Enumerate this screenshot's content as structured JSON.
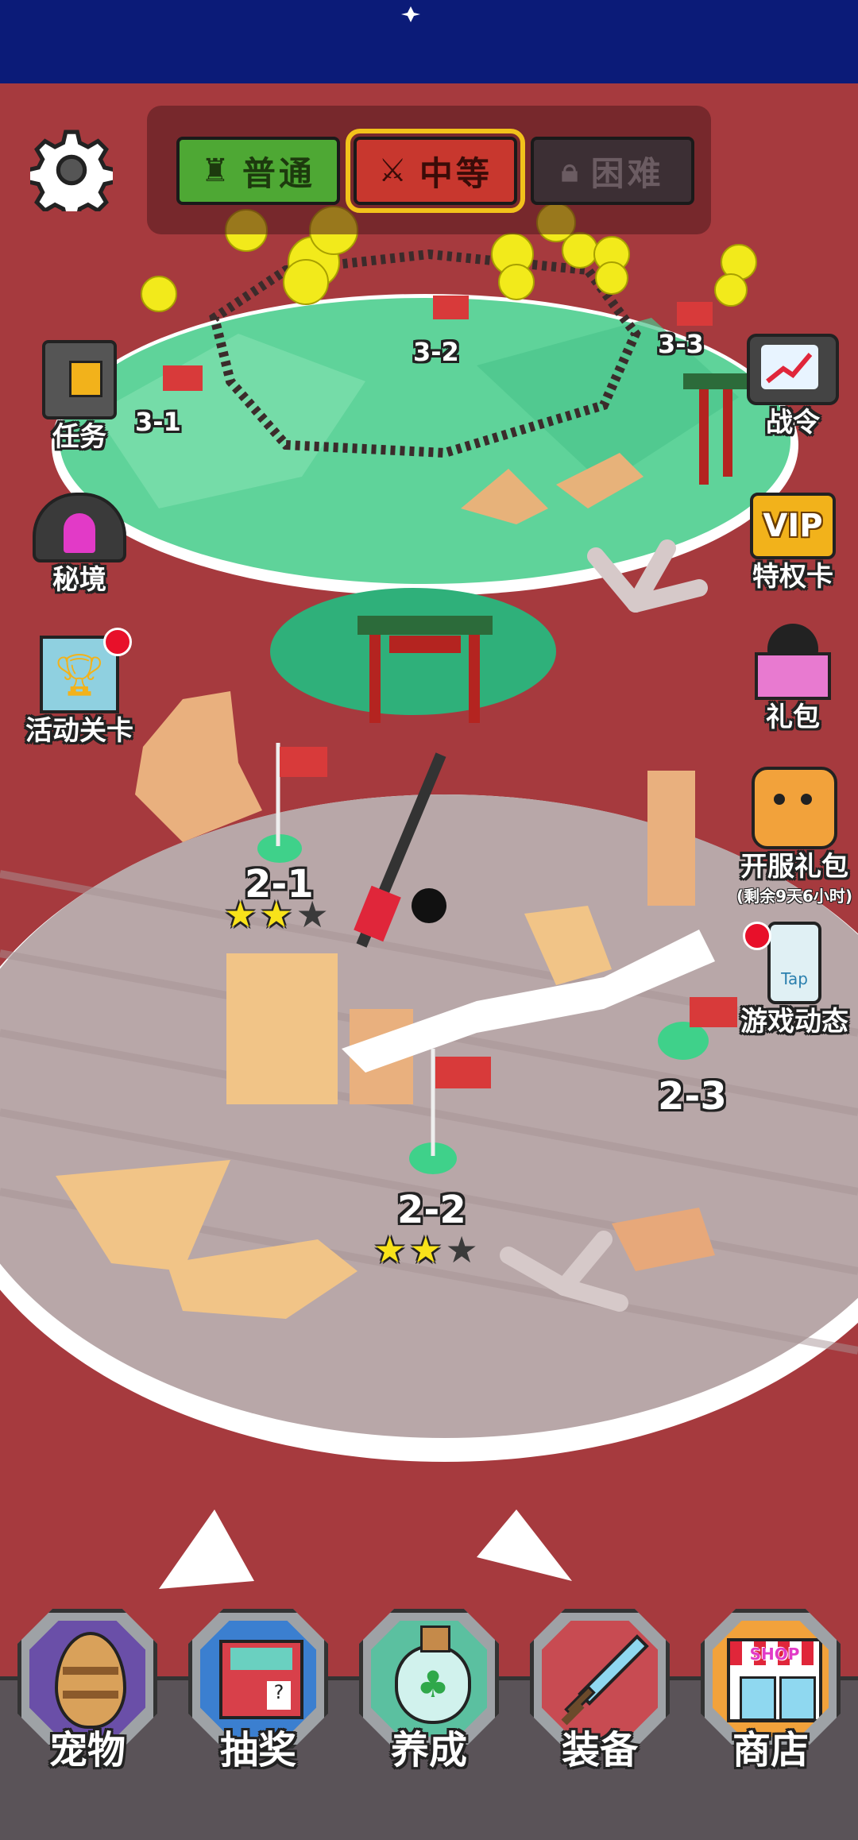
{
  "difficulty": {
    "normal": "普通",
    "medium": "中等",
    "hard": "困难",
    "selected": "medium"
  },
  "left_buttons": {
    "tasks": "任务",
    "secret": "秘境",
    "event_stage": "活动关卡"
  },
  "right_buttons": {
    "battle_pass": "战令",
    "vip_card": "特权卡",
    "vip_badge": "VIP",
    "gift_pack": "礼包",
    "launch_gift": "开服礼包",
    "launch_gift_timer": "(剩余9天6小时)",
    "game_news": "游戏动态",
    "game_news_phone": "Tap"
  },
  "levels": [
    {
      "id": "3-1",
      "label": "3-1"
    },
    {
      "id": "3-2",
      "label": "3-2"
    },
    {
      "id": "3-3",
      "label": "3-3"
    },
    {
      "id": "2-1",
      "label": "2-1",
      "stars": 2
    },
    {
      "id": "2-2",
      "label": "2-2",
      "stars": 2
    },
    {
      "id": "2-3",
      "label": "2-3"
    }
  ],
  "bottom_nav": {
    "pet": "宠物",
    "lottery": "抽奖",
    "cultivate": "养成",
    "equipment": "装备",
    "shop": "商店",
    "shop_sign": "SHOP"
  },
  "colors": {
    "sky": "#0b1b78",
    "ground": "#a63a3e",
    "island_green": "#5fd39a",
    "sand": "#b8a7a8",
    "normal_btn": "#4ea834",
    "medium_btn": "#c8372e",
    "hard_btn": "#3c2f34"
  }
}
